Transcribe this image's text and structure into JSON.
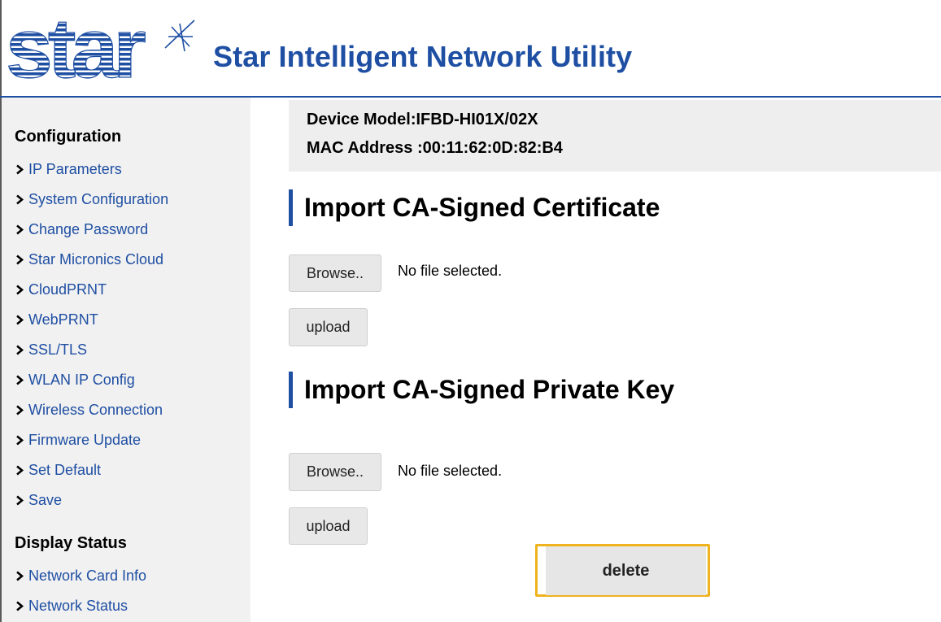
{
  "header": {
    "logo_text": "star",
    "title": "Star Intelligent Network Utility"
  },
  "sidebar": {
    "sections": [
      {
        "title": "Configuration",
        "items": [
          {
            "label": "IP Parameters"
          },
          {
            "label": "System Configuration"
          },
          {
            "label": "Change Password"
          },
          {
            "label": "Star Micronics Cloud"
          },
          {
            "label": "CloudPRNT"
          },
          {
            "label": "WebPRNT"
          },
          {
            "label": "SSL/TLS"
          },
          {
            "label": "WLAN IP Config"
          },
          {
            "label": "Wireless Connection"
          },
          {
            "label": "Firmware Update"
          },
          {
            "label": "Set Default"
          },
          {
            "label": "Save"
          }
        ]
      },
      {
        "title": "Display Status",
        "items": [
          {
            "label": "Network Card Info"
          },
          {
            "label": "Network Status"
          }
        ]
      }
    ]
  },
  "device": {
    "model": "Device Model:IFBD-HI01X/02X",
    "mac": "MAC Address :00:11:62:0D:82:B4"
  },
  "certificate_section": {
    "heading": "Import CA-Signed Certificate",
    "browse_label": "Browse..",
    "file_status": "No file selected.",
    "upload_label": "upload"
  },
  "key_section": {
    "heading": "Import CA-Signed Private Key",
    "browse_label": "Browse..",
    "file_status": "No file selected.",
    "upload_label": "upload"
  },
  "delete_label": "delete",
  "colors": {
    "brand_blue": "#1f4fa3",
    "highlight": "#f0b320",
    "sidebar_bg": "#f1f1f1"
  }
}
